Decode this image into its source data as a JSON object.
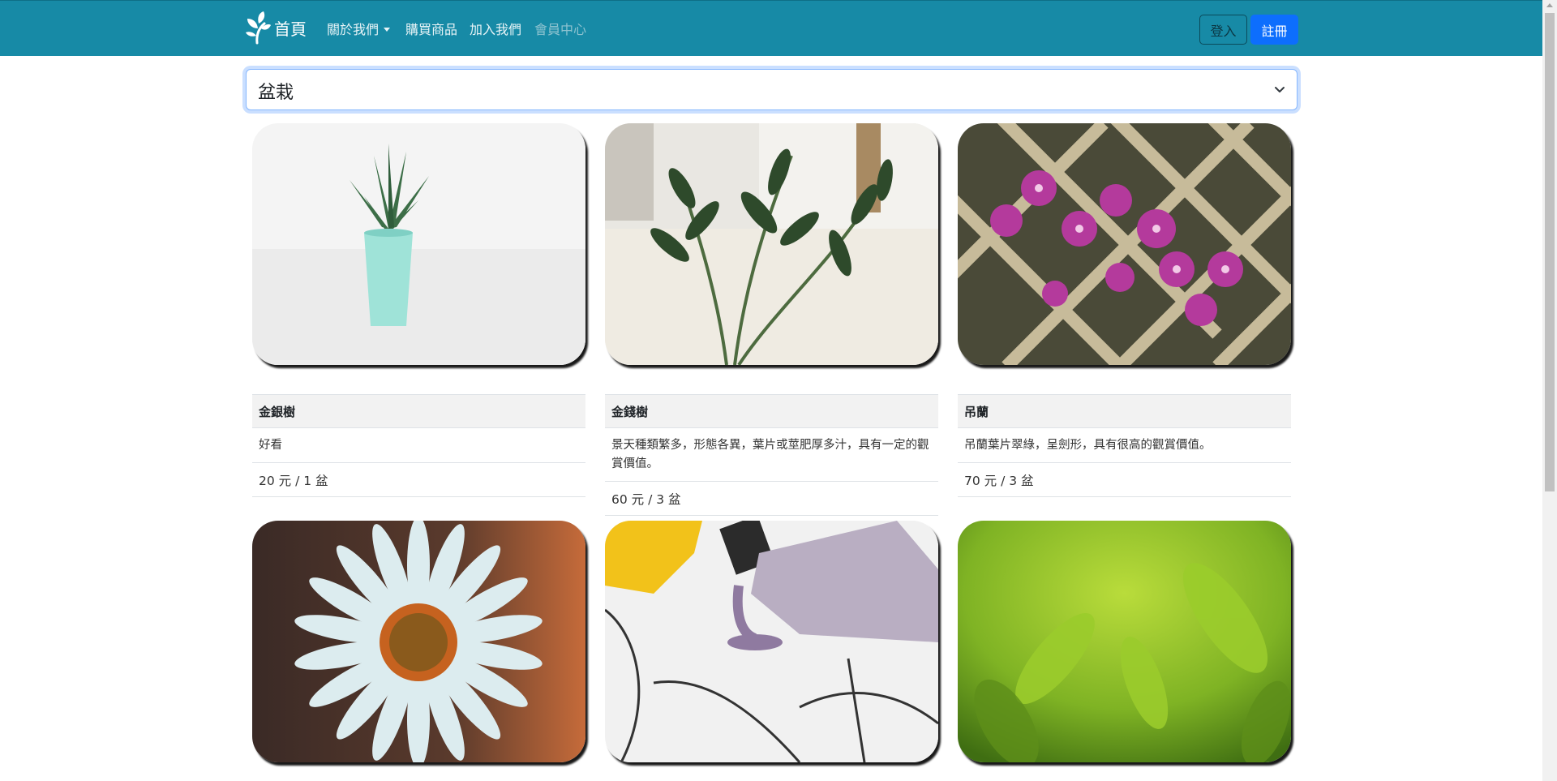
{
  "navbar": {
    "brand_label": "首頁",
    "links": [
      {
        "label": "關於我們",
        "has_dropdown": true
      },
      {
        "label": "購買商品"
      },
      {
        "label": "加入我們"
      },
      {
        "label": "會員中心",
        "disabled": true
      }
    ],
    "login_label": "登入",
    "register_label": "註冊",
    "colors": {
      "navbar_bg": "#178aa6",
      "register_bg": "#0d6efd"
    }
  },
  "category_select": {
    "selected": "盆栽"
  },
  "products": [
    {
      "name": "金銀樹",
      "description": "好看",
      "price": "20 元 / 1 盆",
      "image": "succulent-in-mint-pot"
    },
    {
      "name": "金錢樹",
      "description": "景天種類繁多，形態各異，葉片或莖肥厚多汁，具有一定的觀賞價值。",
      "price": "60 元 / 3 盆",
      "image": "zz-plant"
    },
    {
      "name": "吊蘭",
      "description": "吊蘭葉片翠綠，呈劍形，具有很高的觀賞價值。",
      "price": "70 元 / 3 盆",
      "image": "purple-orchids-lattice"
    },
    {
      "image": "white-daisy"
    },
    {
      "image": "purple-nail-polish"
    },
    {
      "image": "green-tea-leaves"
    }
  ]
}
